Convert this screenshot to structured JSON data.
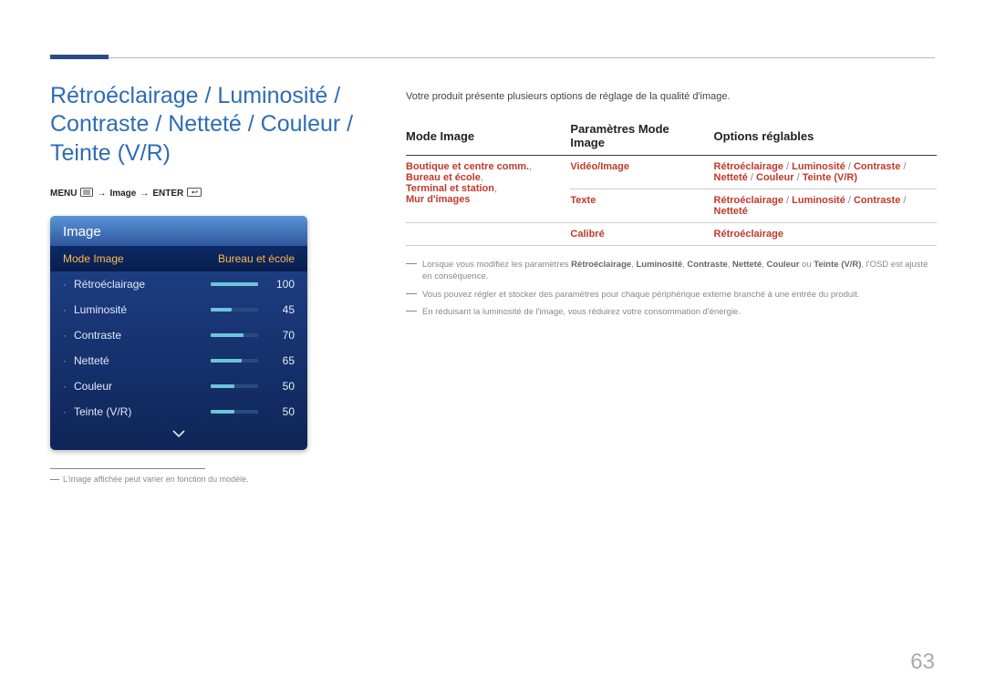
{
  "page_number": "63",
  "heading": "Rétroéclairage / Luminosité / Contraste / Netteté / Couleur / Teinte (V/R)",
  "nav": {
    "menu": "MENU",
    "arrow1": "→",
    "img": "Image",
    "arrow2": "→",
    "enter": "ENTER"
  },
  "osd": {
    "title": "Image",
    "mode_label": "Mode Image",
    "mode_value": "Bureau et école",
    "items": [
      {
        "label": "Rétroéclairage",
        "value": "100",
        "fill": "100%"
      },
      {
        "label": "Luminosité",
        "value": "45",
        "fill": "45%"
      },
      {
        "label": "Contraste",
        "value": "70",
        "fill": "70%"
      },
      {
        "label": "Netteté",
        "value": "65",
        "fill": "65%"
      },
      {
        "label": "Couleur",
        "value": "50",
        "fill": "50%"
      },
      {
        "label": "Teinte (V/R)",
        "value": "50",
        "fill": "50%"
      }
    ]
  },
  "footnote_model": "L'image affichée peut varier en fonction du modèle.",
  "intro": "Votre produit présente plusieurs options de réglage de la qualité d'image.",
  "table": {
    "headers": [
      "Mode Image",
      "Paramètres Mode Image",
      "Options réglables"
    ],
    "rows": [
      {
        "c0_l1": "Boutique et centre comm.",
        "c0_l2": "Bureau et école",
        "c0_l3": "Terminal et station",
        "c0_l4": "Mur d'images",
        "sep": ",",
        "c1_l1": "Vidéo/Image",
        "c1_l2": "Texte",
        "c2_l1a": "Rétroéclairage",
        "c2_l1b": "Luminosité",
        "c2_l1c": "Contraste",
        "c2_l2a": "Netteté",
        "c2_l2b": "Couleur",
        "c2_l2c": "Teinte (V/R)",
        "c2_l3a": "Rétroéclairage",
        "c2_l3b": "Luminosité",
        "c2_l3c": "Contraste",
        "c2_l4a": "Netteté",
        "slash": " / "
      },
      {
        "c0": "",
        "c1": "Calibré",
        "c2": "Rétroéclairage"
      }
    ]
  },
  "notes": {
    "n1_pre": "Lorsque vous modifiez les paramètres ",
    "n1_b1": "Rétroéclairage",
    "n1_b2": "Luminosité",
    "n1_b3": "Contraste",
    "n1_b4": "Netteté",
    "n1_b5": "Couleur",
    "n1_ou": " ou ",
    "n1_b6": "Teinte (V/R)",
    "n1_post": ", l'OSD est ajusté en conséquence.",
    "n1_sep": ", ",
    "n2": "Vous pouvez régler et stocker des paramètres pour chaque périphérique externe branché à une entrée du produit.",
    "n3": "En réduisant la luminosité de l'image, vous réduirez votre consommation d'énergie."
  }
}
